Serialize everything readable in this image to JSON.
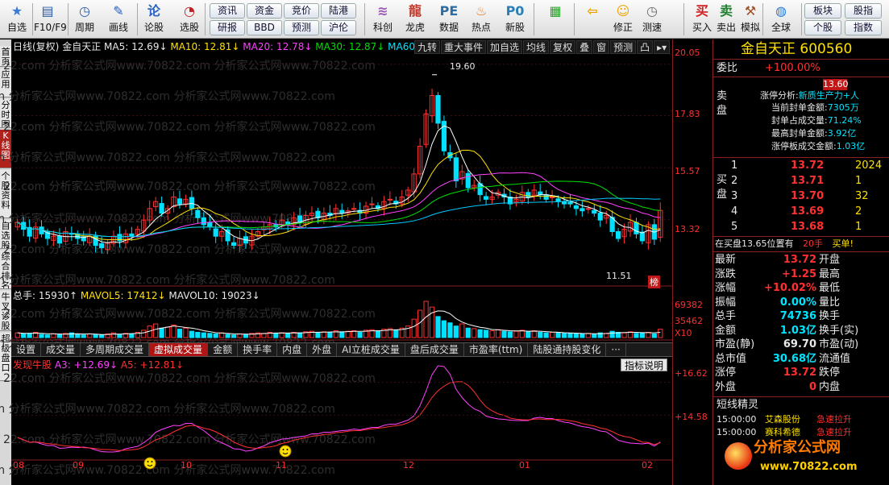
{
  "toolbar": {
    "items": [
      {
        "label": "自选",
        "icon": "★"
      },
      {
        "label": "F10/F9",
        "icon": "▤"
      },
      {
        "label": "周期",
        "icon": "◷"
      },
      {
        "label": "画线",
        "icon": "✎"
      },
      {
        "label": "论股",
        "icon": "论"
      },
      {
        "label": "选股",
        "icon": "◔"
      },
      {
        "label": "科创",
        "icon": "≋"
      },
      {
        "label": "龙虎",
        "icon": "龍"
      },
      {
        "label": "数据",
        "icon": "PE"
      },
      {
        "label": "热点",
        "icon": "♨"
      },
      {
        "label": "新股",
        "icon": "P0"
      },
      {
        "label": "",
        "icon": "▦"
      },
      {
        "label": "",
        "icon": "⇦"
      },
      {
        "label": "修正",
        "icon": "☺"
      },
      {
        "label": "测速",
        "icon": "◷"
      },
      {
        "label": "买入",
        "icon": "买"
      },
      {
        "label": "卖出",
        "icon": "卖"
      },
      {
        "label": "模拟",
        "icon": "⚒"
      },
      {
        "label": "全球",
        "icon": "◍"
      }
    ],
    "grid_buttons": [
      "资讯",
      "资金",
      "竞价",
      "陆港",
      "研报",
      "BBD",
      "预测",
      "沪伦"
    ],
    "right_buttons": [
      "板块",
      "股指",
      "个股",
      "指数"
    ]
  },
  "sidenav": [
    "首页",
    "应用",
    "分时图",
    "K线图",
    "个股资料",
    "自选股",
    "综合排名",
    "牛叉诊股",
    "超级盘口"
  ],
  "chart_header": {
    "period": "日线(复权)",
    "name": "金自天正",
    "ma5": "MA5: 12.69↓",
    "ma10": "MA10: 12.81↓",
    "ma20": "MA20: 12.78↓",
    "ma30": "MA30: 12.87↓",
    "ma60": "MA60: 13."
  },
  "ktools": [
    "九转",
    "重大事件",
    "加自选",
    "均线",
    "复权",
    "叠",
    "窗",
    "预测",
    "凸"
  ],
  "annotations": {
    "high": "19.60",
    "low": "11.51",
    "bang": "榜"
  },
  "volume_header": {
    "total": "总手: 15930↑",
    "mavol5": "MAVOL5: 17412↓",
    "mavol10": "MAVOL10: 19023↓"
  },
  "vol_scale": [
    "69382",
    "35462",
    "X10"
  ],
  "ktabs": [
    "设置",
    "成交量",
    "多周期成交量",
    "虚拟成交量",
    "金额",
    "换手率",
    "内盘",
    "外盘",
    "AI立桩成交量",
    "盘后成交量",
    "市盈率(ttm)",
    "陆股通持股变化",
    "···"
  ],
  "ktabs_active": 3,
  "indicator_header": {
    "name": "发现牛股",
    "a3": "A3: +12.69↓",
    "a5": "A5: +12.81↓",
    "help": "指标说明"
  },
  "price_scale": [
    "20.05",
    "17.83",
    "15.57",
    "13.32"
  ],
  "ind_scale": [
    "+16.62",
    "+14.58"
  ],
  "x_axis": [
    "08",
    "09",
    "10",
    "11",
    "12",
    "01",
    "02"
  ],
  "quote": {
    "title": "金自天正 600560",
    "webi_label": "委比",
    "webi": "+100.00%",
    "webi_value": "13.60",
    "sell_label": "卖盘",
    "buy_label": "买盘",
    "limit_title": "涨停分析:",
    "limit_theme": "新质生产力+人",
    "limit_rows": [
      [
        "当前封单金额:",
        "7305万"
      ],
      [
        "封单占成交量:",
        "71.24%"
      ],
      [
        "最高封单金额:",
        "3.92亿"
      ],
      [
        "涨停板成交金额:",
        "1.03亿"
      ]
    ],
    "bids": [
      [
        "1",
        "13.72",
        "2024"
      ],
      [
        "2",
        "13.71",
        "1"
      ],
      [
        "3",
        "13.70",
        "32"
      ],
      [
        "4",
        "13.69",
        "2"
      ],
      [
        "5",
        "13.68",
        "1"
      ]
    ],
    "position": "在买盘13.65位置有",
    "position_qty": "20手",
    "position_tag": "买单!",
    "stats": [
      [
        "最新",
        "13.72",
        "开盘",
        "13.05"
      ],
      [
        "涨跌",
        "+1.25",
        "最高",
        "13.72"
      ],
      [
        "涨幅",
        "+10.02%",
        "最低",
        "13.00"
      ],
      [
        "振幅",
        "0.00%",
        "量比",
        "1.25"
      ],
      [
        "总手",
        "74736",
        "换手",
        "1.56%"
      ],
      [
        "金额",
        "1.03亿",
        "换手(实)",
        "4.16%"
      ],
      [
        "市盈(静)",
        "69.70",
        "市盈(动)",
        "85.33"
      ],
      [
        "总市值",
        "30.68亿",
        "流通值",
        "30.68亿"
      ],
      [
        "涨停",
        "13.72",
        "跌停",
        "11.22"
      ],
      [
        "外盘",
        "0",
        "内盘",
        "0"
      ]
    ],
    "sprite_title": "短线精灵",
    "sprite_rows": [
      [
        "15:00:00",
        "艾森股份",
        "急速拉升"
      ],
      [
        "15:00:00",
        "赛科希德",
        "急速拉升"
      ]
    ],
    "logo_text": "分析家公式网",
    "logo_url": "www.70822.com"
  },
  "watermark": "22.com 分析家公式网www.70822.com 分析家公式网www.70822.com",
  "chart_data": {
    "type": "candlestick",
    "title": "金自天正 日线(复权)",
    "ylim": [
      11.0,
      20.5
    ],
    "x_ticks": [
      "08",
      "09",
      "10",
      "11",
      "12",
      "01",
      "02"
    ],
    "high_mark": 19.6,
    "low_mark": 11.51,
    "closes": [
      13.2,
      12.9,
      12.6,
      13.0,
      12.7,
      12.5,
      12.6,
      12.3,
      12.8,
      12.7,
      12.5,
      12.4,
      12.6,
      12.2,
      12.1,
      12.3,
      12.6,
      12.4,
      12.7,
      12.6,
      12.9,
      13.3,
      13.8,
      14.1,
      13.6,
      13.8,
      14.3,
      14.0,
      14.2,
      13.8,
      13.4,
      13.1,
      13.0,
      12.6,
      12.8,
      12.4,
      12.2,
      12.5,
      12.3,
      12.6,
      12.8,
      13.0,
      13.1,
      13.0,
      13.3,
      13.1,
      13.4,
      13.2,
      13.5,
      13.6,
      13.4,
      13.6,
      13.5,
      13.8,
      13.6,
      13.7,
      13.8,
      13.6,
      13.9,
      14.0,
      13.8,
      14.1,
      14.2,
      14.0,
      14.3,
      14.6,
      15.3,
      16.5,
      17.9,
      18.7,
      17.5,
      16.3,
      16.0,
      15.0,
      15.4,
      14.7,
      14.8,
      14.4,
      14.2,
      14.3,
      14.5,
      14.3,
      14.0,
      14.2,
      14.5,
      14.3,
      14.6,
      14.4,
      14.2,
      14.3,
      14.1,
      14.0,
      14.0,
      13.8,
      13.7,
      13.8,
      13.6,
      13.3,
      13.5,
      12.8,
      12.5,
      12.9,
      13.2,
      12.7,
      12.4,
      13.1,
      12.47,
      13.72
    ],
    "volumes": [
      9,
      7,
      8,
      10,
      6,
      5,
      7,
      6,
      8,
      9,
      6,
      5,
      7,
      6,
      5,
      7,
      9,
      6,
      8,
      7,
      10,
      14,
      22,
      26,
      18,
      20,
      24,
      16,
      18,
      12,
      10,
      9,
      8,
      7,
      9,
      6,
      5,
      7,
      6,
      8,
      9,
      8,
      10,
      8,
      9,
      8,
      10,
      9,
      11,
      12,
      9,
      11,
      10,
      13,
      11,
      12,
      13,
      10,
      14,
      15,
      12,
      16,
      17,
      14,
      18,
      22,
      35,
      52,
      69,
      58,
      40,
      32,
      28,
      22,
      26,
      18,
      17,
      15,
      14,
      13,
      15,
      12,
      11,
      12,
      14,
      11,
      13,
      10,
      9,
      10,
      9,
      8,
      8,
      7,
      7,
      8,
      6,
      9,
      8,
      12,
      10,
      9,
      11,
      8,
      9,
      10,
      7,
      16
    ],
    "indicator": {
      "a3_last": 12.69,
      "a5_last": 12.81,
      "scale": [
        14.58,
        16.62
      ]
    }
  }
}
